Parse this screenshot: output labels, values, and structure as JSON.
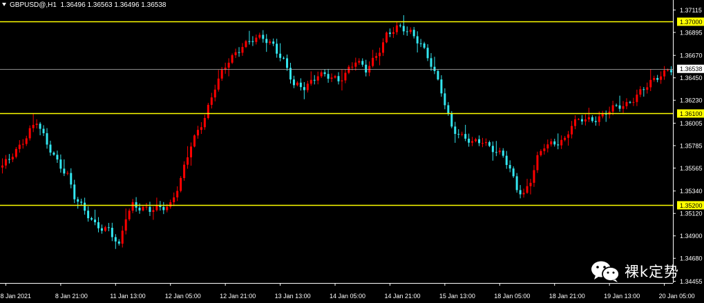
{
  "header": {
    "symbol": "GBPUSD@,H1",
    "ohlc": "1.36496 1.36563 1.36496 1.36538"
  },
  "watermark": {
    "text": "裸k定势",
    "logo_icon": "wechat-icon"
  },
  "colors": {
    "background": "#000000",
    "bull": "#ff0000",
    "bear": "#33e6f0",
    "level_line": "#ffff00",
    "price_line": "#bbbbbb",
    "axis": "#ffffff"
  },
  "chart_data": {
    "type": "candlestick",
    "title": "",
    "xlabel": "",
    "ylabel": "",
    "ylim": [
      1.34438,
      1.37213
    ],
    "grid": false,
    "y_ticks": [
      "1.37115",
      "1.36895",
      "1.36670",
      "1.36450",
      "1.36230",
      "1.36005",
      "1.35785",
      "1.35565",
      "1.35340",
      "1.35120",
      "1.34900",
      "1.34680",
      "1.34455"
    ],
    "y_tick_values": [
      1.37115,
      1.36895,
      1.3667,
      1.3645,
      1.3623,
      1.36005,
      1.35785,
      1.35565,
      1.3534,
      1.3512,
      1.349,
      1.3468,
      1.34455
    ],
    "x_ticks": [
      {
        "label": "8 Jan 2021",
        "bar": 1
      },
      {
        "label": "8 Jan 21:00",
        "bar": 17
      },
      {
        "label": "11 Jan 13:00",
        "bar": 33
      },
      {
        "label": "12 Jan 05:00",
        "bar": 49
      },
      {
        "label": "12 Jan 21:00",
        "bar": 65
      },
      {
        "label": "13 Jan 13:00",
        "bar": 81
      },
      {
        "label": "14 Jan 05:00",
        "bar": 97
      },
      {
        "label": "14 Jan 21:00",
        "bar": 113
      },
      {
        "label": "15 Jan 13:00",
        "bar": 129
      },
      {
        "label": "18 Jan 05:00",
        "bar": 145
      },
      {
        "label": "18 Jan 21:00",
        "bar": 161
      },
      {
        "label": "19 Jan 13:00",
        "bar": 177
      },
      {
        "label": "20 Jan 05:00",
        "bar": 193
      }
    ],
    "levels": [
      {
        "label": "1.37000",
        "value": 1.37,
        "type": "horizontal-line"
      },
      {
        "label": "1.36100",
        "value": 1.361,
        "type": "horizontal-line"
      },
      {
        "label": "1.35200",
        "value": 1.352,
        "type": "horizontal-line"
      }
    ],
    "current_price": {
      "label": "1.36538",
      "value": 1.36538
    },
    "anchors": [
      [
        0,
        1.3559
      ],
      [
        2,
        1.3564
      ],
      [
        5,
        1.3577
      ],
      [
        8,
        1.3595
      ],
      [
        10,
        1.3603
      ],
      [
        13,
        1.3578
      ],
      [
        16,
        1.3563
      ],
      [
        19,
        1.3551
      ],
      [
        21,
        1.3528
      ],
      [
        24,
        1.3513
      ],
      [
        27,
        1.3502
      ],
      [
        31,
        1.3496
      ],
      [
        34,
        1.3478
      ],
      [
        36,
        1.3509
      ],
      [
        38,
        1.3522
      ],
      [
        41,
        1.3517
      ],
      [
        43,
        1.3514
      ],
      [
        46,
        1.3517
      ],
      [
        49,
        1.3522
      ],
      [
        52,
        1.3545
      ],
      [
        55,
        1.3578
      ],
      [
        59,
        1.3608
      ],
      [
        62,
        1.3636
      ],
      [
        66,
        1.3661
      ],
      [
        70,
        1.3678
      ],
      [
        73,
        1.3682
      ],
      [
        76,
        1.3683
      ],
      [
        79,
        1.3678
      ],
      [
        82,
        1.3662
      ],
      [
        85,
        1.3636
      ],
      [
        88,
        1.3636
      ],
      [
        92,
        1.3649
      ],
      [
        95,
        1.3645
      ],
      [
        98,
        1.3642
      ],
      [
        101,
        1.3655
      ],
      [
        103,
        1.3662
      ],
      [
        106,
        1.3651
      ],
      [
        109,
        1.3667
      ],
      [
        112,
        1.3688
      ],
      [
        115,
        1.3693
      ],
      [
        119,
        1.369
      ],
      [
        122,
        1.368
      ],
      [
        125,
        1.3657
      ],
      [
        128,
        1.3631
      ],
      [
        131,
        1.3598
      ],
      [
        134,
        1.3587
      ],
      [
        137,
        1.358
      ],
      [
        140,
        1.3584
      ],
      [
        143,
        1.3576
      ],
      [
        146,
        1.3567
      ],
      [
        148,
        1.3554
      ],
      [
        150,
        1.3537
      ],
      [
        152,
        1.3532
      ],
      [
        154,
        1.3545
      ],
      [
        156,
        1.3565
      ],
      [
        158,
        1.3577
      ],
      [
        161,
        1.3582
      ],
      [
        164,
        1.3585
      ],
      [
        166,
        1.3598
      ],
      [
        169,
        1.3604
      ],
      [
        172,
        1.3605
      ],
      [
        175,
        1.3608
      ],
      [
        178,
        1.3614
      ],
      [
        182,
        1.362
      ],
      [
        185,
        1.3628
      ],
      [
        188,
        1.3636
      ],
      [
        191,
        1.3646
      ],
      [
        194,
        1.3654
      ],
      [
        195,
        1.3654
      ]
    ],
    "bar_count": 196
  }
}
